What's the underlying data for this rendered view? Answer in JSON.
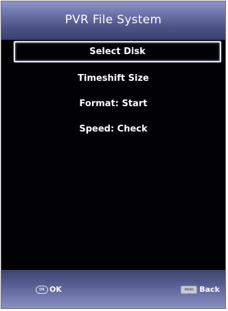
{
  "window": {
    "title": "PVR File System"
  },
  "menu": {
    "items": [
      {
        "label": "Select Disk",
        "selected": true
      },
      {
        "label": "Timeshift Size",
        "selected": false
      },
      {
        "label": "Format: Start",
        "selected": false
      },
      {
        "label": "Speed: Check",
        "selected": false
      }
    ]
  },
  "footer": {
    "ok_icon_text": "OK",
    "ok_label": "OK",
    "back_icon_text": "MENU",
    "back_label": "Back"
  },
  "colors": {
    "title_bar": "#6e76ac",
    "background": "#020204",
    "selection_border": "#e9eaf2"
  }
}
